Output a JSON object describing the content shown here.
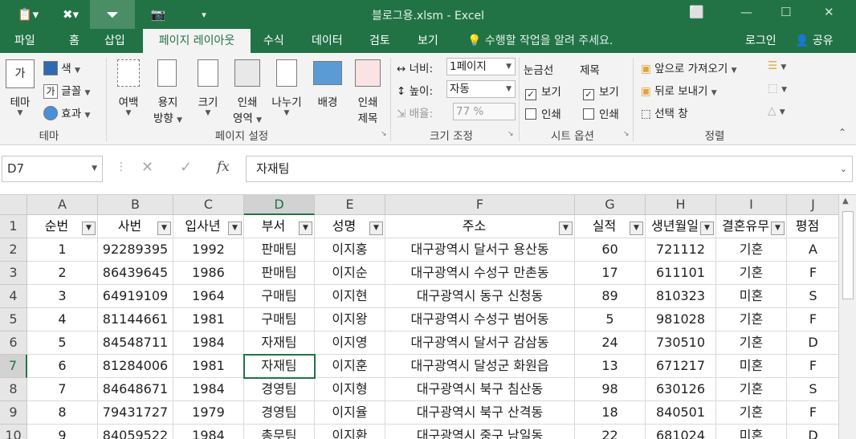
{
  "titlebar": {
    "title": "블로그용.xlsm - Excel",
    "qat": [
      "paste-icon",
      "clear-format-icon",
      "filter-icon",
      "camera-icon",
      "customize-icon"
    ]
  },
  "tabs": [
    "파일",
    "홈",
    "삽입",
    "페이지 레이아웃",
    "수식",
    "데이터",
    "검토",
    "보기"
  ],
  "tellme": "수행할 작업을 알려 주세요.",
  "signin": "로그인",
  "share": "공유",
  "ribbon": {
    "theme": {
      "themes": "테마",
      "colors": "색",
      "fonts": "글꼴",
      "effects": "효과",
      "group": "테마"
    },
    "pagesetup": {
      "margins": "여백",
      "orient1": "용지",
      "orient2": "방향",
      "size": "크기",
      "area1": "인쇄",
      "area2": "영역",
      "breaks": "나누기",
      "bg": "배경",
      "titles1": "인쇄",
      "titles2": "제목",
      "group": "페이지 설정"
    },
    "scale": {
      "width_label": "너비:",
      "width_val": "1페이지",
      "height_label": "높이:",
      "height_val": "자동",
      "scale_label": "배율:",
      "scale_val": "77 %",
      "group": "크기 조정"
    },
    "sheet": {
      "grid": "눈금선",
      "headings": "제목",
      "view": "보기",
      "print": "인쇄",
      "group": "시트 옵션"
    },
    "arrange": {
      "forward": "앞으로 가져오기",
      "backward": "뒤로 보내기",
      "pane": "선택 창",
      "group": "정렬"
    }
  },
  "formula": {
    "namebox": "D7",
    "fx": "fx",
    "value": "자재팀"
  },
  "grid": {
    "cols": [
      "A",
      "B",
      "C",
      "D",
      "E",
      "F",
      "G",
      "H",
      "I",
      "J"
    ],
    "headers": [
      "순번",
      "사번",
      "입사년",
      "부서",
      "성명",
      "주소",
      "실적",
      "생년월일",
      "결혼유무",
      "평점"
    ],
    "rows": [
      [
        "1",
        "92289395",
        "1992",
        "판매팀",
        "이지홍",
        "대구광역시 달서구 용산동",
        "60",
        "721112",
        "기혼",
        "A"
      ],
      [
        "2",
        "86439645",
        "1986",
        "판매팀",
        "이지순",
        "대구광역시 수성구 만촌동",
        "17",
        "611101",
        "기혼",
        "F"
      ],
      [
        "3",
        "64919109",
        "1964",
        "구매팀",
        "이지현",
        "대구광역시 동구 신청동",
        "89",
        "810323",
        "미혼",
        "S"
      ],
      [
        "4",
        "81144661",
        "1981",
        "구매팀",
        "이지왕",
        "대구광역시 수성구 범어동",
        "5",
        "981028",
        "기혼",
        "F"
      ],
      [
        "5",
        "84548711",
        "1984",
        "자재팀",
        "이지영",
        "대구광역시 달서구 감삼동",
        "24",
        "730510",
        "기혼",
        "D"
      ],
      [
        "6",
        "81284006",
        "1981",
        "자재팀",
        "이지훈",
        "대구광역시 달성군 화원읍",
        "13",
        "671217",
        "미혼",
        "F"
      ],
      [
        "7",
        "84648671",
        "1984",
        "경영팀",
        "이지형",
        "대구광역시 북구 침산동",
        "98",
        "630126",
        "기혼",
        "S"
      ],
      [
        "8",
        "79431727",
        "1979",
        "경영팀",
        "이지율",
        "대구광역시 북구 산격동",
        "18",
        "840501",
        "기혼",
        "F"
      ],
      [
        "9",
        "84059522",
        "1984",
        "총무팀",
        "이지환",
        "대구광역시 중구 남일동",
        "22",
        "681024",
        "미혼",
        "D"
      ]
    ],
    "rownums": [
      "1",
      "2",
      "3",
      "4",
      "5",
      "6",
      "7",
      "8",
      "9",
      "10"
    ]
  }
}
